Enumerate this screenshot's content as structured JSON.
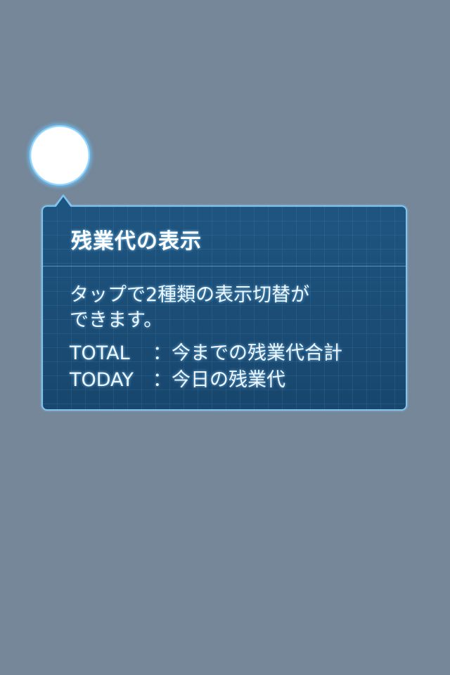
{
  "tooltip": {
    "title": "残業代の表示",
    "description_lines": [
      "タップで2種類の表示切替が",
      "できます。"
    ],
    "legend": [
      {
        "key": "TOTAL",
        "sep": "：",
        "text": "今までの残業代合計"
      },
      {
        "key": "TODAY",
        "sep": "：",
        "text": "今日の残業代"
      }
    ]
  },
  "colors": {
    "background": "#758799",
    "panel": "#1d4f78",
    "border": "#7fc4ef",
    "glow": "#8fd3ff"
  }
}
